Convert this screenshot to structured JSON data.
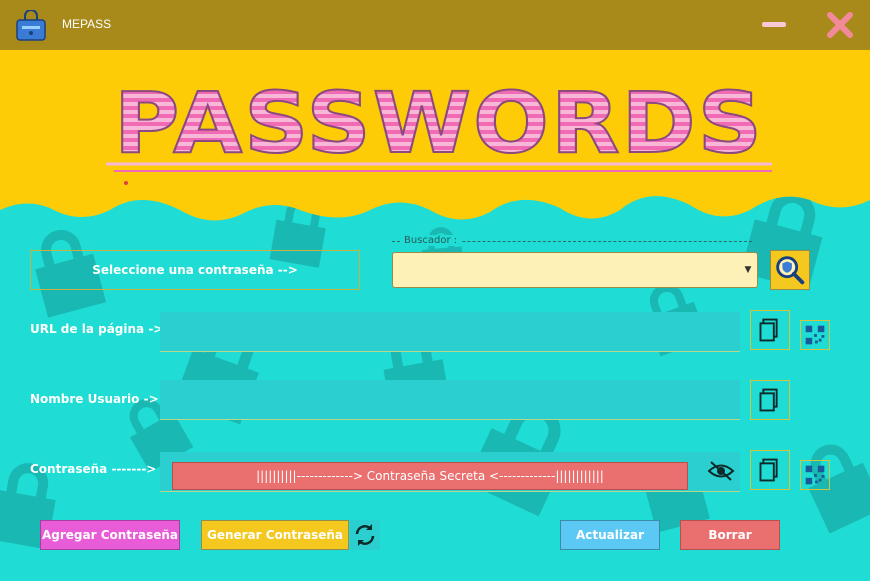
{
  "window": {
    "title": "MEPASS"
  },
  "banner": {
    "text": "PASSWORDS"
  },
  "selector": {
    "label": "Seleccione una contraseña -->"
  },
  "search": {
    "group_label": "Buscador :",
    "value": ""
  },
  "fields": {
    "url_label": "URL de la página ->",
    "user_label": "Nombre Usuario ->",
    "password_label": "Contraseña ------->",
    "password_mask": "||||||||||-------------> Contraseña Secreta <-------------||||||||||||"
  },
  "buttons": {
    "add": "Agregar Contraseña",
    "generate": "Generar Contraseña",
    "update": "Actualizar",
    "delete": "Borrar"
  },
  "colors": {
    "titlebar": "#a88a1a",
    "header": "#fecc06",
    "body": "#1fdcd4",
    "banner_pink": "#f06ab4",
    "add": "#e85cd8",
    "generate": "#f4c81e",
    "update": "#5cc8f4",
    "delete": "#ea6f6f"
  }
}
